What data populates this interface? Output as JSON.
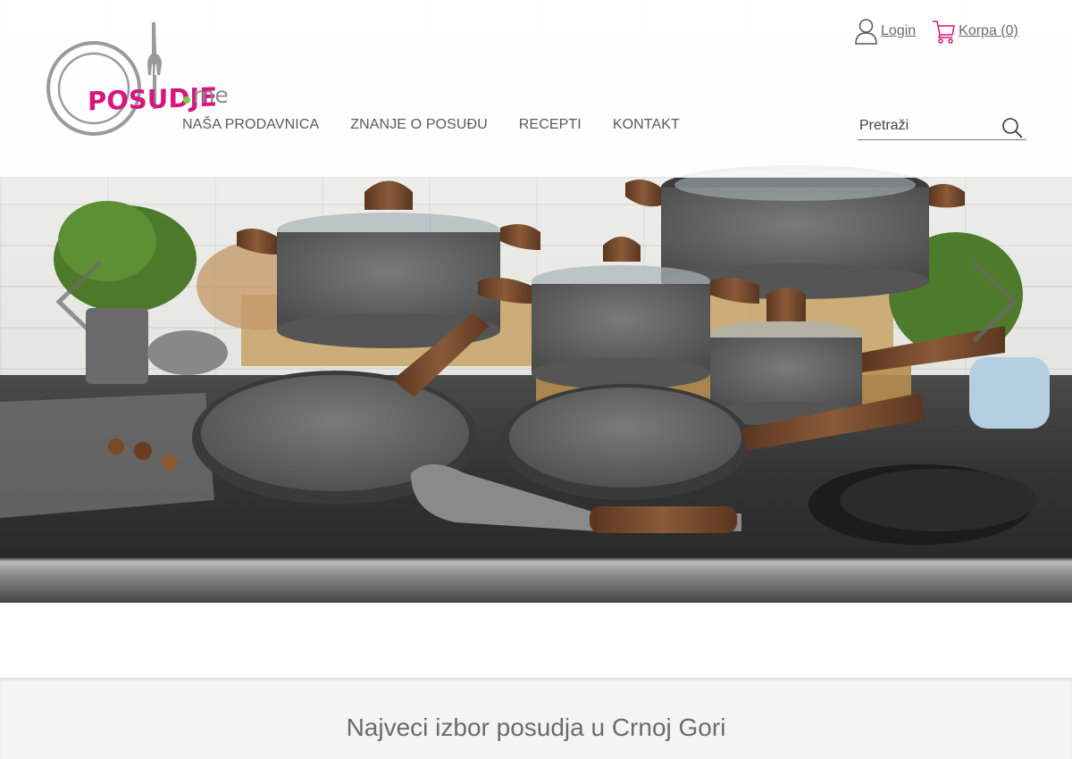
{
  "brand": {
    "logo_text": "POSUDJE",
    "logo_suffix": "me",
    "colors": {
      "primary": "#d6177e",
      "accent": "#8cc63f",
      "text": "#5a5a5a"
    }
  },
  "header": {
    "login_label": "Login",
    "cart_label": "Korpa (0)",
    "nav": [
      {
        "label": "NAŠA PRODAVNICA"
      },
      {
        "label": "ZNANJE O POSUĐU"
      },
      {
        "label": "RECEPTI"
      },
      {
        "label": "KONTAKT"
      }
    ],
    "search": {
      "placeholder": "Pretraži",
      "icon": "search-icon"
    }
  },
  "hero": {
    "icons": {
      "prev": "chevron-left-icon",
      "next": "chevron-right-icon"
    }
  },
  "section": {
    "title": "Najveci izbor posudja u Crnoj Gori"
  }
}
